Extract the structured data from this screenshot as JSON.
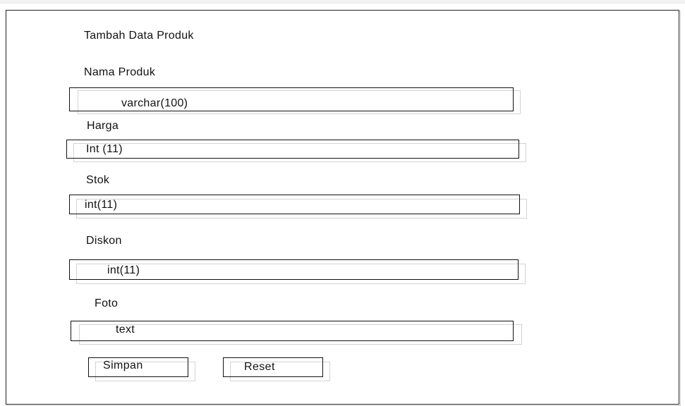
{
  "form": {
    "title": "Tambah Data Produk",
    "fields": [
      {
        "label": "Nama Produk",
        "value": "varchar(100)"
      },
      {
        "label": "Harga",
        "value": "Int (11)"
      },
      {
        "label": "Stok",
        "value": "int(11)"
      },
      {
        "label": "Diskon",
        "value": "int(11)"
      },
      {
        "label": "Foto",
        "value": "text"
      }
    ],
    "buttons": {
      "save_label": "Simpan",
      "reset_label": "Reset"
    }
  }
}
